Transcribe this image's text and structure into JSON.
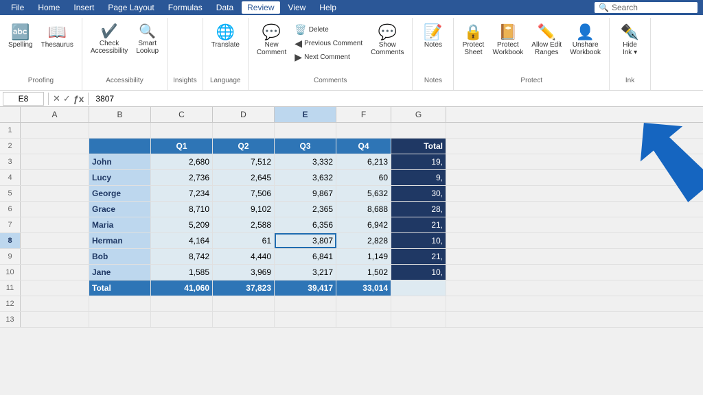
{
  "menubar": {
    "items": [
      "File",
      "Home",
      "Insert",
      "Page Layout",
      "Formulas",
      "Data",
      "Review",
      "View",
      "Help"
    ]
  },
  "ribbon": {
    "active_tab": "Review",
    "groups": [
      {
        "label": "Proofing",
        "buttons": [
          {
            "id": "spelling",
            "icon": "🔤",
            "label": "Spelling"
          },
          {
            "id": "thesaurus",
            "icon": "📖",
            "label": "Thesaurus"
          }
        ]
      },
      {
        "label": "Accessibility",
        "buttons": [
          {
            "id": "check-accessibility",
            "icon": "✔️",
            "label": "Check\nAccessibility"
          },
          {
            "id": "smart-lookup",
            "icon": "🔍",
            "label": "Smart\nLookup"
          }
        ]
      },
      {
        "label": "Language",
        "buttons": [
          {
            "id": "translate",
            "icon": "🌐",
            "label": "Translate"
          }
        ]
      },
      {
        "label": "Comments",
        "buttons": [
          {
            "id": "new-comment",
            "icon": "💬",
            "label": "New\nComment"
          },
          {
            "id": "delete",
            "icon": "🗑️",
            "label": "Delete"
          },
          {
            "id": "prev-comment",
            "icon": "◀",
            "label": "Previous\nComment"
          },
          {
            "id": "next-comment",
            "icon": "▶",
            "label": "Next\nComment"
          },
          {
            "id": "show-comments",
            "icon": "💬",
            "label": "Show\nComments"
          }
        ]
      },
      {
        "label": "Notes",
        "buttons": [
          {
            "id": "notes",
            "icon": "📝",
            "label": "Notes"
          }
        ]
      },
      {
        "label": "Protect",
        "buttons": [
          {
            "id": "protect-sheet",
            "icon": "🔒",
            "label": "Protect\nSheet"
          },
          {
            "id": "protect-workbook",
            "icon": "📔",
            "label": "Protect\nWorkbook"
          },
          {
            "id": "allow-edit",
            "icon": "✏️",
            "label": "Allow Edit\nRanges"
          },
          {
            "id": "unshare",
            "icon": "👤",
            "label": "Unshare\nWorkbook"
          }
        ]
      },
      {
        "label": "Ink",
        "buttons": [
          {
            "id": "hide-ink",
            "icon": "✒️",
            "label": "Hide\nInk"
          }
        ]
      }
    ]
  },
  "formula_bar": {
    "cell_ref": "E8",
    "formula": "3807"
  },
  "search": {
    "placeholder": "Search",
    "value": "Search"
  },
  "columns": {
    "headers": [
      "",
      "A",
      "B",
      "C",
      "D",
      "E",
      "F",
      "G"
    ],
    "labels": [
      "",
      "",
      "",
      "Q1",
      "Q2",
      "Q3",
      "Q4",
      "Total"
    ]
  },
  "rows": [
    {
      "num": "1",
      "cells": [
        "",
        "",
        "",
        "",
        "",
        "",
        "",
        ""
      ]
    },
    {
      "num": "2",
      "cells": [
        "",
        "",
        "",
        "Q1",
        "Q2",
        "Q3",
        "Q4",
        "Total"
      ],
      "type": "header"
    },
    {
      "num": "3",
      "cells": [
        "",
        "John",
        "2,680",
        "7,512",
        "3,332",
        "6,213",
        "19,"
      ],
      "type": "data"
    },
    {
      "num": "4",
      "cells": [
        "",
        "Lucy",
        "2,736",
        "2,645",
        "3,632",
        "60",
        "9,"
      ],
      "type": "data"
    },
    {
      "num": "5",
      "cells": [
        "",
        "George",
        "7,234",
        "7,506",
        "9,867",
        "5,632",
        "30,"
      ],
      "type": "data"
    },
    {
      "num": "6",
      "cells": [
        "",
        "Grace",
        "8,710",
        "9,102",
        "2,365",
        "8,688",
        "28,"
      ],
      "type": "data"
    },
    {
      "num": "7",
      "cells": [
        "",
        "Maria",
        "5,209",
        "2,588",
        "6,356",
        "6,942",
        "21,"
      ],
      "type": "data"
    },
    {
      "num": "8",
      "cells": [
        "",
        "Herman",
        "4,164",
        "61",
        "3,807",
        "2,828",
        "10,"
      ],
      "type": "data",
      "selected_col": 4
    },
    {
      "num": "9",
      "cells": [
        "",
        "Bob",
        "8,742",
        "4,440",
        "6,841",
        "1,149",
        "21,"
      ],
      "type": "data"
    },
    {
      "num": "10",
      "cells": [
        "",
        "Jane",
        "1,585",
        "3,969",
        "3,217",
        "1,502",
        "10,"
      ],
      "type": "data"
    },
    {
      "num": "11",
      "cells": [
        "",
        "Total",
        "41,060",
        "37,823",
        "39,417",
        "33,014",
        ""
      ],
      "type": "total"
    },
    {
      "num": "12",
      "cells": [
        "",
        "",
        "",
        "",
        "",
        "",
        "",
        ""
      ]
    },
    {
      "num": "13",
      "cells": [
        "",
        "",
        "",
        "",
        "",
        "",
        "",
        ""
      ]
    }
  ],
  "selected_cell": "E8",
  "arrow": {
    "direction": "upper-right",
    "color": "#1565C0"
  }
}
